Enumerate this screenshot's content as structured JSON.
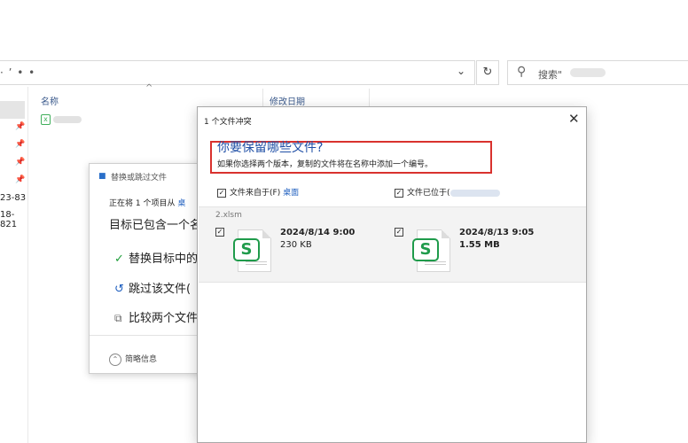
{
  "explorer": {
    "address_text": "· ’ • •",
    "dropdown_icon": "chevron-down-icon",
    "refresh_icon": "refresh-icon",
    "search_placeholder": "搜索\"",
    "nav_numbers": [
      "23-83",
      "18-821"
    ],
    "col_name": "名称",
    "col_date": "修改日期"
  },
  "replace_dialog": {
    "title": "替换或跳过文件",
    "line1_prefix": "正在将 1 个项目从 ",
    "line1_link": "桌",
    "line2": "目标已包含一个名",
    "opt_replace": "替换目标中的",
    "opt_skip": "跳过该文件(",
    "opt_compare": "比较两个文件",
    "more_info": "简略信息"
  },
  "conflict_dialog": {
    "title": "1 个文件冲突",
    "close": "✕",
    "heading": "你要保留哪些文件?",
    "subtext": "如果你选择两个版本，复制的文件将在名称中添加一个编号。",
    "source_label": "文件来自于(F) ",
    "source_link": "桌面",
    "dest_label": "文件已位于(",
    "filename": "2.xlsm",
    "left_file": {
      "date": "2024/8/14 9:00",
      "size": "230 KB",
      "checked": true
    },
    "right_file": {
      "date": "2024/8/13 9:05",
      "size": "1.55 MB",
      "checked": true
    },
    "file_icon_letter": "S",
    "accent_color": "#1f4fa6",
    "highlight_color": "#d9322e",
    "file_icon_color": "#1f9b4b"
  }
}
